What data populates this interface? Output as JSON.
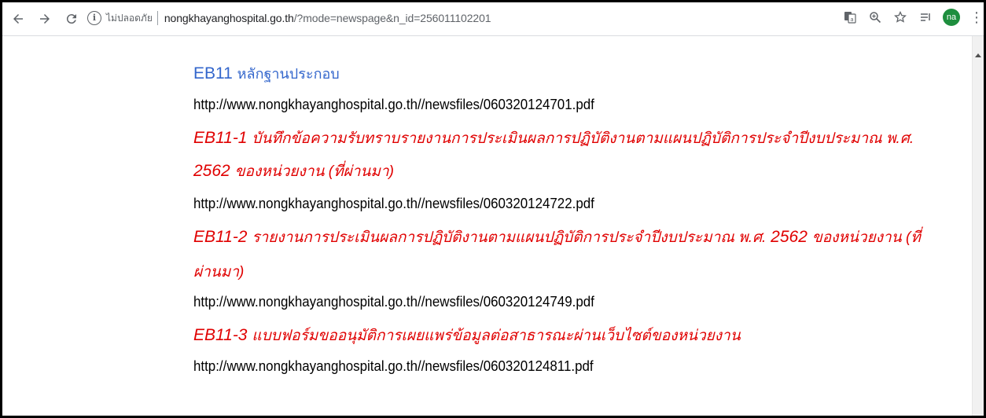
{
  "browser": {
    "back_icon": "arrow-left-icon",
    "forward_icon": "arrow-right-icon",
    "reload_icon": "reload-icon",
    "security_label": "ไม่ปลอดภัย",
    "url_host": "nongkhayanghospital.go.th",
    "url_path": "/?mode=newspage&n_id=256011102201",
    "avatar_initials": "na",
    "avatar_color": "#1e8e3e"
  },
  "page": {
    "heading_code": "EB11",
    "heading_title": "หลักฐานประกอบ",
    "link_1": "http://www.nongkhayanghospital.go.th//newsfiles/060320124701.pdf",
    "item_1_code": "EB11-1",
    "item_1_title_a": "บันทึกข้อความรับทราบรายงานการประเมินผลการปฏิบัติงานตามแผนปฏิบัติการประจำปีงบประมาณ พ.ศ.",
    "item_1_year": "2562",
    "item_1_title_b": "ของหน่วยงาน (ที่ผ่านมา)",
    "link_2": "http://www.nongkhayanghospital.go.th//newsfiles/060320124722.pdf",
    "item_2_code": "EB11-2",
    "item_2_title_a": "รายงานการประเมินผลการปฏิบัติงานตามแผนปฏิบัติการประจำปีงบประมาณ พ.ศ.",
    "item_2_year": "2562",
    "item_2_title_b": "ของหน่วยงาน (ที่",
    "item_2_title_c": "ผ่านมา)",
    "link_3": "http://www.nongkhayanghospital.go.th//newsfiles/060320124749.pdf",
    "item_3_code": "EB11-3",
    "item_3_title": "แบบฟอร์มขออนุมัติการเผยแพร่ข้อมูลต่อสาธารณะผ่านเว็บไซต์ของหน่วยงาน",
    "link_4": "http://www.nongkhayanghospital.go.th//newsfiles/060320124811.pdf",
    "heading_color": "#3366cc",
    "item_color": "#e00000"
  }
}
